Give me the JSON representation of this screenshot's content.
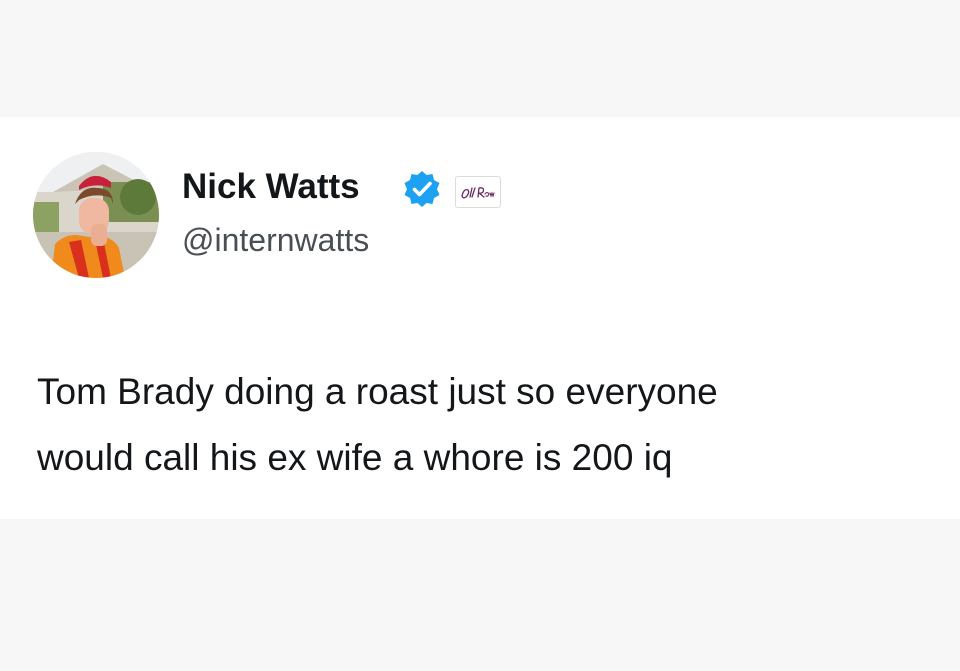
{
  "tweet": {
    "author": {
      "display_name": "Nick Watts",
      "handle": "@internwatts",
      "verified_icon": "verified-badge-icon",
      "affiliate_badge_icon": "old-row-logo-icon"
    },
    "text_lines": [
      "Tom Brady doing a roast just so everyone",
      "would call his ex wife a whore is 200 iq"
    ]
  },
  "colors": {
    "page_background": "#f7f7f7",
    "card_background": "#ffffff",
    "name_text": "#14171a",
    "handle_text": "#4a4f55",
    "verified_blue": "#1da1f2"
  }
}
